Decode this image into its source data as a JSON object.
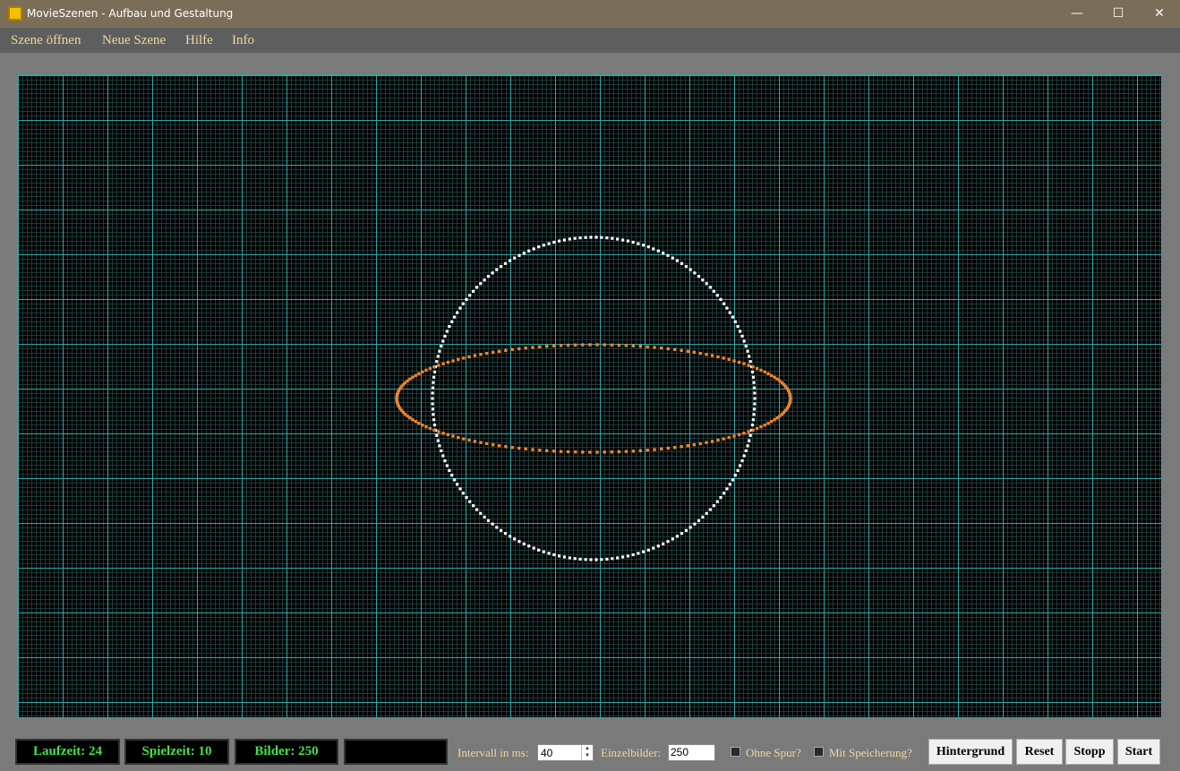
{
  "window": {
    "title": "MovieSzenen - Aufbau und Gestaltung",
    "minimize_glyph": "—",
    "maximize_glyph": "☐",
    "close_glyph": "✕"
  },
  "menu": {
    "items": [
      "Szene öffnen",
      "Neue Szene",
      "Hilfe",
      "Info"
    ]
  },
  "canvas": {
    "background": "#000000",
    "grid_major_color": "#2fa8a8",
    "grid_minor_color": "#1e3a3a",
    "shapes": [
      {
        "name": "white-circle",
        "color": "#ffffff"
      },
      {
        "name": "orange-ellipse",
        "color": "#f0852a"
      }
    ]
  },
  "status": {
    "laufzeit": "Laufzeit: 24",
    "spielzeit": "Spielzeit: 10",
    "bilder": "Bilder: 250",
    "empty_display": ""
  },
  "controls": {
    "intervall_label": "Intervall in ms:",
    "intervall_value": "40",
    "einzelbilder_label": "Einzelbilder:",
    "einzelbilder_value": "250",
    "ohne_spur_label": "Ohne Spur?",
    "ohne_spur_checked": false,
    "mit_speicherung_label": "Mit Speicherung?",
    "mit_speicherung_checked": false
  },
  "buttons": {
    "hintergrund": "Hintergrund",
    "reset": "Reset",
    "stopp": "Stopp",
    "start": "Start"
  }
}
